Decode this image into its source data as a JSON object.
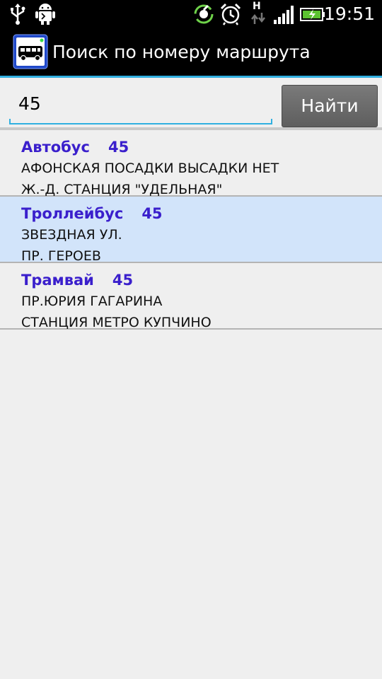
{
  "status_bar": {
    "time": "19:51",
    "network_type": "H",
    "icons": [
      "usb-icon",
      "android-debug-icon",
      "sync-icon",
      "alarm-icon",
      "network-activity-icon",
      "signal-icon",
      "battery-icon"
    ],
    "battery_color": "#5cc231"
  },
  "app_bar": {
    "title": "Поиск по номеру маршрута",
    "icon": "bus-icon",
    "accent_color": "#31b0e0"
  },
  "search": {
    "value": "45",
    "placeholder": "",
    "button_label": "Найти"
  },
  "routes": [
    {
      "type": "Автобус",
      "number": "45",
      "from": "АФОНСКАЯ ПОСАДКИ ВЫСАДКИ НЕТ",
      "to": "Ж.-Д. СТАНЦИЯ \"УДЕЛЬНАЯ\"",
      "selected": false
    },
    {
      "type": "Троллейбус",
      "number": "45",
      "from": "ЗВЕЗДНАЯ УЛ.",
      "to": "ПР. ГЕРОЕВ",
      "selected": true
    },
    {
      "type": "Трамвай",
      "number": "45",
      "from": "ПР.ЮРИЯ ГАГАРИНА",
      "to": "СТАНЦИЯ МЕТРО КУПЧИНО",
      "selected": false
    }
  ],
  "colors": {
    "route_title": "#3a1fcc",
    "selected_row": "#d2e4fa",
    "background": "#efefef"
  }
}
